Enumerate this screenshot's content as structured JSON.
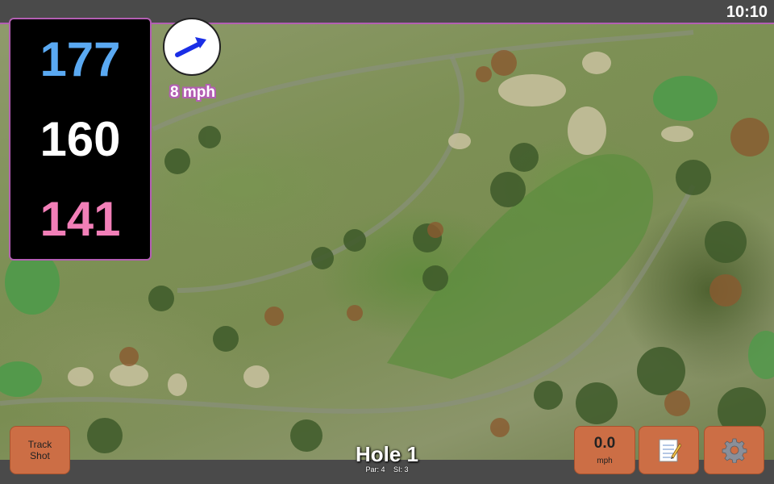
{
  "status": {
    "time": "10:10"
  },
  "distances": {
    "back": "177",
    "center": "160",
    "front": "141"
  },
  "wind": {
    "speed_label": "8 mph",
    "direction_icon": "arrow-right-up-icon"
  },
  "hole": {
    "title": "Hole 1",
    "par_label": "Par: 4",
    "si_label": "SI: 3"
  },
  "buttons": {
    "track_shot_line1": "Track",
    "track_shot_line2": "Shot",
    "speed_value": "0.0",
    "speed_unit": "mph",
    "notes_icon": "notepad-icon",
    "settings_icon": "gear-icon"
  },
  "colors": {
    "back_distance": "#5aa9f2",
    "center_distance": "#ffffff",
    "front_distance": "#f27fb8",
    "accent": "#b35fb3",
    "button": "#cc6e45"
  }
}
